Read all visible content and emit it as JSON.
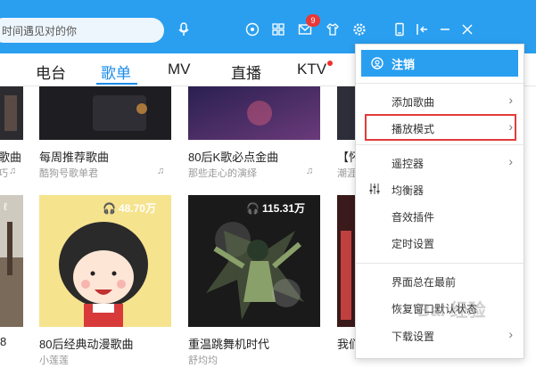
{
  "search": {
    "value": "时间遇见对的你"
  },
  "header": {
    "mail_badge": "9"
  },
  "tabs": [
    {
      "label": "电台"
    },
    {
      "label": "歌单"
    },
    {
      "label": "MV"
    },
    {
      "label": "直播"
    },
    {
      "label": "KTV"
    }
  ],
  "cards_row1": [
    {
      "title": "每周推荐歌曲",
      "subtitle": "酷狗号歌单君"
    },
    {
      "title": "80后K歌必点金曲",
      "subtitle": "那些走心的演绎"
    },
    {
      "title": "【怀",
      "subtitle": "潮涯"
    }
  ],
  "cards_row2": [
    {
      "title": "80后经典动漫歌曲",
      "subtitle": "小莲莲",
      "plays": "48.70万"
    },
    {
      "title": "重温跳舞机时代",
      "subtitle": "舒均均",
      "plays": "115.31万"
    },
    {
      "title": "我们",
      "subtitle": ""
    }
  ],
  "menu": {
    "header": "注销",
    "items": [
      {
        "label": "添加歌曲"
      },
      {
        "label": "播放模式"
      },
      {
        "label": "遥控器"
      },
      {
        "label": "均衡器"
      },
      {
        "label": "音效插件"
      },
      {
        "label": "定时设置"
      },
      {
        "label": "界面总在最前"
      },
      {
        "label": "恢复窗口默认状态"
      },
      {
        "label": "下载设置"
      }
    ]
  },
  "watermark": "Bai 经验",
  "colors": {
    "accent": "#2a9ff0",
    "active_tab": "#1a8ceb",
    "highlight": "#e23b3b"
  }
}
